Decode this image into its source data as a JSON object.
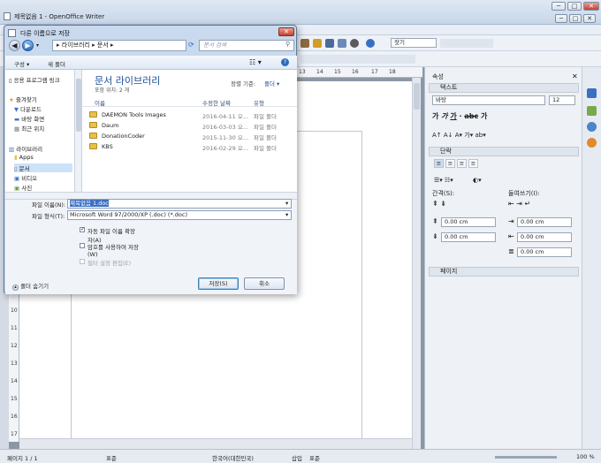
{
  "window": {
    "title": "제목없음 1 - OpenOffice Writer",
    "controls": [
      "─",
      "□",
      "✕"
    ]
  },
  "toolbar": {
    "style_value": "",
    "font_value": "잣기"
  },
  "ruler": {
    "h_ticks": [
      "13",
      "14",
      "15",
      "16",
      "17",
      "18"
    ],
    "v_ticks": [
      "10",
      "11",
      "12",
      "13",
      "14",
      "15",
      "16",
      "17"
    ]
  },
  "dialog": {
    "title": "다른 이름으로 저장",
    "address": [
      "라이브러리",
      "문서"
    ],
    "search_placeholder": "문서 검색",
    "toolbar": {
      "organize": "구성",
      "new_folder": "새 폴더"
    },
    "nav": {
      "recent_programs": "응용 프로그램 링크",
      "favorites_header": "즐겨찾기",
      "favorites": [
        "다운로드",
        "바탕 화면",
        "최근 위치"
      ],
      "libraries_header": "라이브러리",
      "libraries": [
        "Apps",
        "문서",
        "비디오",
        "사진"
      ]
    },
    "library": {
      "title": "문서 라이브러리",
      "subtitle": "포함 위치: 2 개",
      "sort_label": "정렬 기준:",
      "sort_value": "폴더"
    },
    "columns": {
      "name": "이름",
      "date": "수정한 날짜",
      "type": "유형"
    },
    "files": [
      {
        "name": "DAEMON Tools Images",
        "date": "2016-04-11 오...",
        "type": "파일 폴더"
      },
      {
        "name": "Daum",
        "date": "2016-03-03 오...",
        "type": "파일 폴더"
      },
      {
        "name": "DonationCoder",
        "date": "2015-11-30 오...",
        "type": "파일 폴더"
      },
      {
        "name": "KBS",
        "date": "2016-02-29 오...",
        "type": "파일 폴더"
      }
    ],
    "filename_label": "파일 이름(N):",
    "filename_value": "제목없음 1.doc",
    "filetype_label": "파일 형식(T):",
    "filetype_value": "Microsoft Word 97/2000/XP (.doc) (*.doc)",
    "options": [
      {
        "label": "자동 파일 이름 확장\n자(A)",
        "checked": true,
        "enabled": true
      },
      {
        "label": "암호를 사용하여 저장\n(W)",
        "checked": false,
        "enabled": true
      },
      {
        "label": "필터 설정 편집(E)",
        "checked": false,
        "enabled": false
      }
    ],
    "hide_folders": "폴더 숨기기",
    "save_button": "저장(S)",
    "cancel_button": "취소"
  },
  "sidebar": {
    "title": "속성",
    "text_section": "텍스트",
    "font_name": "바탕",
    "font_size": "12",
    "paragraph_section": "단락",
    "spacing_label": "간격(S):",
    "indent_label": "들여쓰기(I):",
    "spin_values": [
      "0.00 cm",
      "0.00 cm",
      "0.00 cm",
      "0.00 cm",
      "0.00 cm"
    ],
    "page_section": "페이지"
  },
  "status": {
    "page": "페이지 1 / 1",
    "style": "표준",
    "language": "한국어(대한민국)",
    "mode": "삽입",
    "selection": "표준",
    "zoom": "100 %"
  },
  "colors": {
    "accent": "#3a70c4",
    "folder": "#e8c04a",
    "close": "#c4402f"
  }
}
